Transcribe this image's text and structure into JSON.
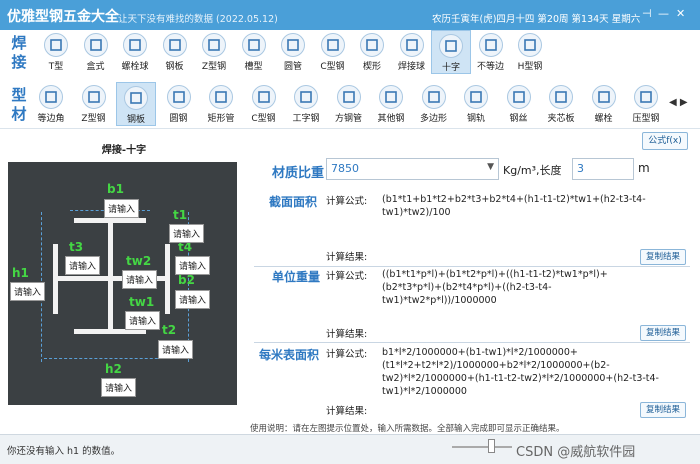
{
  "window": {
    "title": "优雅型钢五金大全",
    "subtitle": "让天下没有难找的数据 (2022.05.12)",
    "date": "农历壬寅年(虎)四月十四 第20周 第134天 星期六"
  },
  "row1": {
    "label": "焊接",
    "items": [
      {
        "label": "T型",
        "icon": "t-section-icon"
      },
      {
        "label": "盒式",
        "icon": "box-section-icon"
      },
      {
        "label": "螺栓球",
        "icon": "bolt-ball-icon"
      },
      {
        "label": "钢板",
        "icon": "steel-plate-icon"
      },
      {
        "label": "Z型钢",
        "icon": "z-section-icon"
      },
      {
        "label": "槽型",
        "icon": "channel-icon"
      },
      {
        "label": "圆管",
        "icon": "round-tube-icon"
      },
      {
        "label": "C型钢",
        "icon": "c-section-icon"
      },
      {
        "label": "楔形",
        "icon": "wedge-icon"
      },
      {
        "label": "焊接球",
        "icon": "welded-ball-icon"
      },
      {
        "label": "十字",
        "icon": "cross-section-icon"
      },
      {
        "label": "不等边",
        "icon": "unequal-angle-icon"
      },
      {
        "label": "H型钢",
        "icon": "h-beam-icon"
      }
    ]
  },
  "row2": {
    "label": "型材",
    "items": [
      {
        "label": "等边角",
        "icon": "equal-angle-icon"
      },
      {
        "label": "Z型钢",
        "icon": "z-section-icon"
      },
      {
        "label": "钢板",
        "icon": "steel-plate-icon"
      },
      {
        "label": "圆钢",
        "icon": "round-bar-icon"
      },
      {
        "label": "矩形管",
        "icon": "rect-tube-icon"
      },
      {
        "label": "C型钢",
        "icon": "c-section-icon"
      },
      {
        "label": "工字钢",
        "icon": "i-beam-icon"
      },
      {
        "label": "方钢管",
        "icon": "square-tube-icon"
      },
      {
        "label": "其他钢",
        "icon": "other-steel-icon"
      },
      {
        "label": "多边形",
        "icon": "polygon-icon"
      },
      {
        "label": "钢轨",
        "icon": "rail-icon"
      },
      {
        "label": "钢丝",
        "icon": "wire-icon"
      },
      {
        "label": "夹芯板",
        "icon": "sandwich-panel-icon"
      },
      {
        "label": "螺栓",
        "icon": "bolt-icon"
      },
      {
        "label": "压型钢",
        "icon": "profiled-steel-icon"
      }
    ]
  },
  "diagram": {
    "title": "焊接-十字",
    "placeholder": "请输入",
    "labels": {
      "b1": "b1",
      "t1": "t1",
      "t3": "t3",
      "t4": "t4",
      "tw2": "tw2",
      "b2": "b2",
      "h1": "h1",
      "tw1": "tw1",
      "t2": "t2",
      "h2": "h2"
    }
  },
  "right": {
    "formula_button": "公式f(x)",
    "density_label": "材质比重",
    "density_value": "7850",
    "density_unit": "Kg/m³,长度",
    "length_value": "3",
    "length_unit": "m",
    "formula_label": "计算公式:",
    "result_label": "计算结果:",
    "copy_button": "复制结果",
    "sections": {
      "area": {
        "title": "截面面积",
        "formula": "(b1*t1+b1*t2+b2*t3+b2*t4+(h1-t1-t2)*tw1+(h2-t3-t4-tw1)*tw2)/100"
      },
      "weight": {
        "title": "单位重量",
        "formula": "((b1*t1*p*l)+(b1*t2*p*l)+((h1-t1-t2)*tw1*p*l)+(b2*t3*p*l)+(b2*t4*p*l)+((h2-t3-t4-tw1)*tw2*p*l))/1000000"
      },
      "surface": {
        "title": "每米表面积",
        "formula": "b1*l*2/1000000+(b1-tw1)*l*2/1000000+(t1*l*2+t2*l*2)/1000000+b2*l*2/1000000+(b2-tw2)*l*2/1000000+(h1-t1-t2-tw2)*l*2/1000000+(h2-t3-t4-tw1)*l*2/1000000"
      }
    },
    "usage": "使用说明：请在左图提示位置处，输入所需数据。全部输入完成即可显示正确结果。"
  },
  "status": {
    "message": "你还没有输入 h1 的数值。",
    "watermark": "CSDN @威航软件园"
  },
  "colors": {
    "titlebar": "#4a9fd8",
    "accent": "#2f79c2",
    "diagram_bg": "#3b4043",
    "label_green": "#44d644"
  }
}
